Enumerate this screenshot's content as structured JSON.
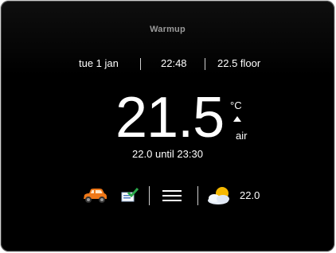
{
  "brand": {
    "name": "Warmup"
  },
  "status": {
    "date": "tue 1 jan",
    "time": "22:48",
    "floor_temp": "22.5 floor"
  },
  "main": {
    "air_temp": "21.5",
    "unit": "°C",
    "sensor": "air",
    "trend_icon": "up-arrow-icon",
    "schedule": "22.0 until 23:30"
  },
  "bottom": {
    "icons": [
      "car-icon",
      "program-icon",
      "menu-icon",
      "weather-icon"
    ],
    "outside_temp": "22.0"
  },
  "colors": {
    "background": "#000000",
    "text": "#ffffff",
    "brand": "#9a9a9a",
    "car": "#f07818",
    "sun": "#f5b800",
    "program_check": "#2aa84a"
  }
}
